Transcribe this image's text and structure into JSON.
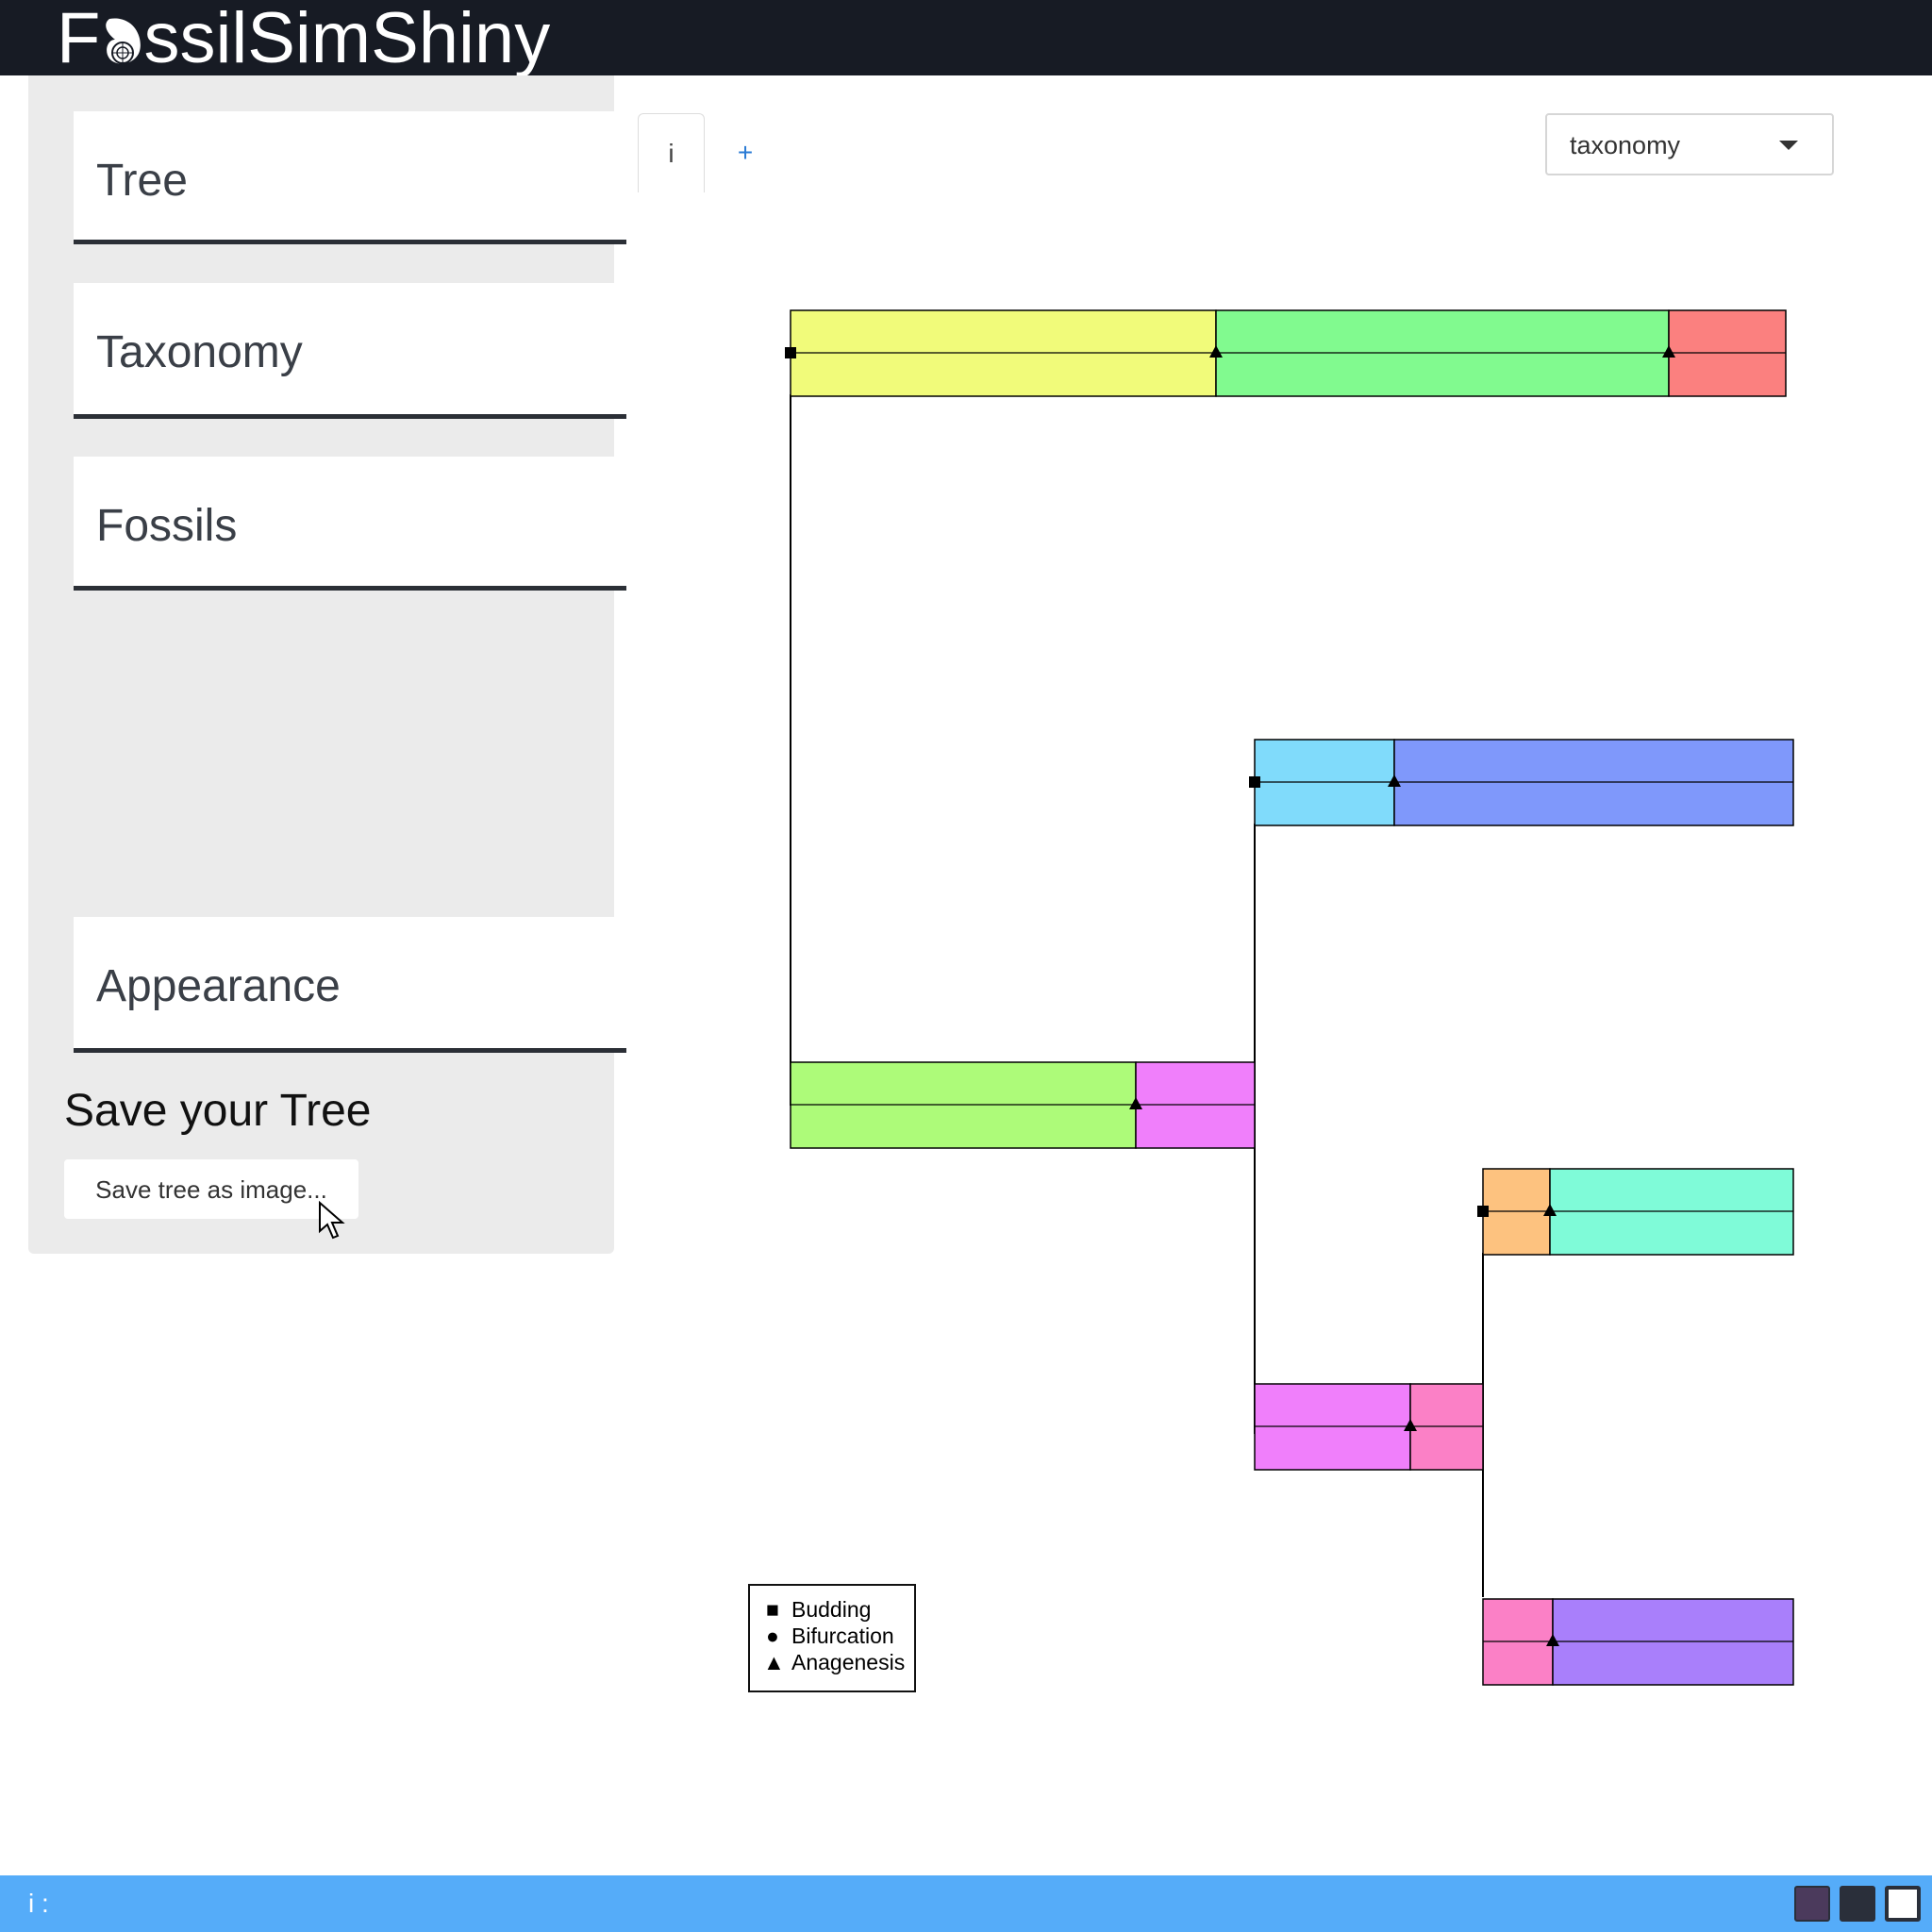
{
  "app": {
    "title_left": "F",
    "title_right": "ssilSimShiny"
  },
  "sidebar": {
    "panels": [
      {
        "label": "Tree"
      },
      {
        "label": "Taxonomy"
      },
      {
        "label": "Fossils"
      },
      {
        "label": "Appearance"
      }
    ],
    "save_heading": "Save your Tree",
    "save_button": "Save tree as image..."
  },
  "tabs": [
    {
      "label": "i"
    },
    {
      "label": "+"
    }
  ],
  "view_select": {
    "value": "taxonomy"
  },
  "legend": {
    "items": [
      {
        "symbol": "■",
        "label": "Budding"
      },
      {
        "symbol": "●",
        "label": "Bifurcation"
      },
      {
        "symbol": "▲",
        "label": "Anagenesis"
      }
    ]
  },
  "colors": {
    "topbar": "#171b24",
    "sidebar": "#ebebeb",
    "statusbar": "#55acf9",
    "species": [
      "#f1fb7a",
      "#81fa8f",
      "#fb807f",
      "#80dbfb",
      "#7f98fb",
      "#adfb79",
      "#f07ffb",
      "#fdc27f",
      "#7ffbd8",
      "#f07ffb",
      "#fb80c6",
      "#fb80c6",
      "#a97ffb"
    ]
  },
  "status": {
    "text": "i :"
  }
}
